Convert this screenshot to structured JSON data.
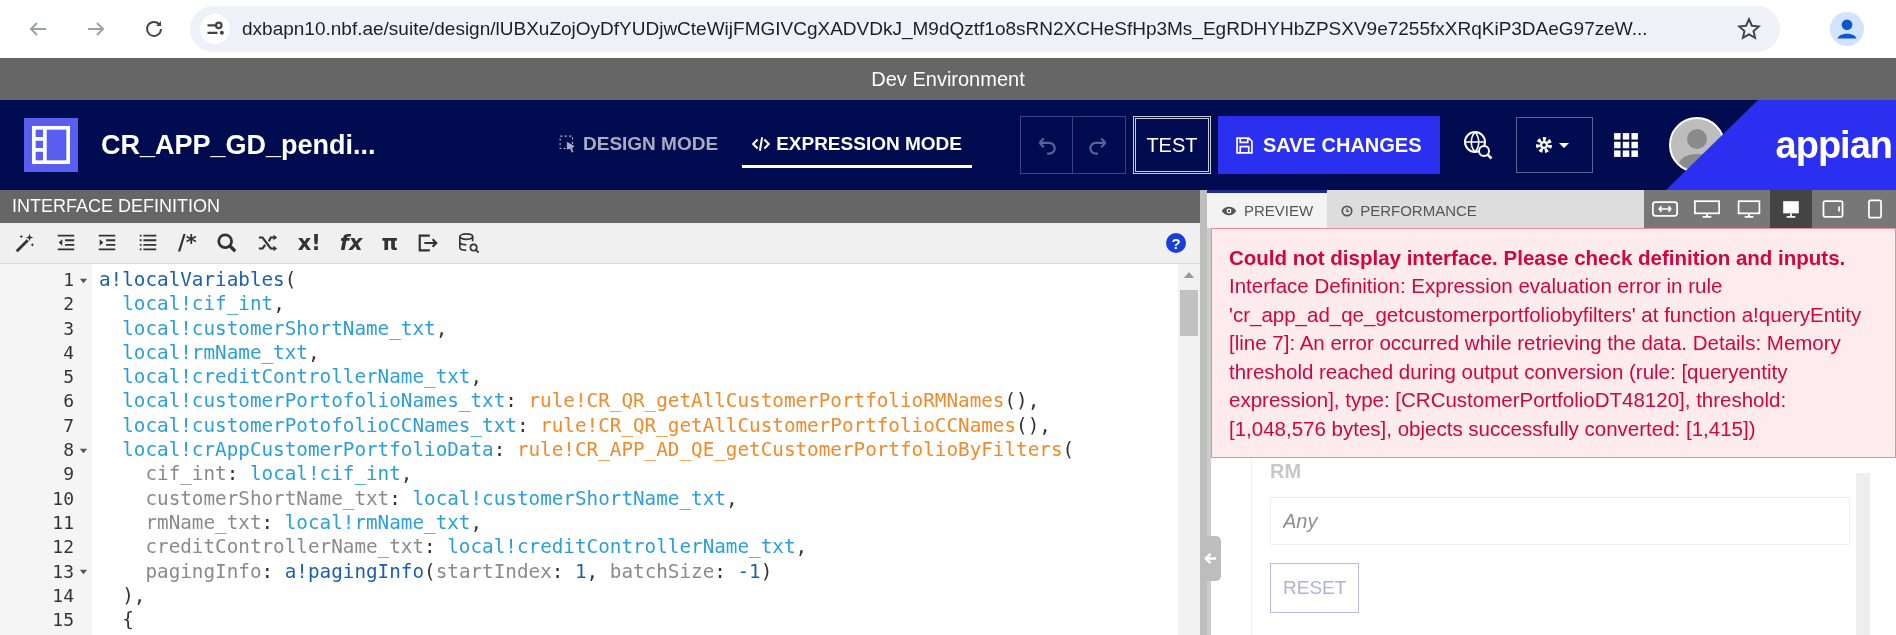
{
  "browser": {
    "url": "dxbapn10.nbf.ae/suite/design/lUBXuZojOyDfYUDjwCteWijFMGIVCgXADVDkJ_M9dQztf1o8sRN2XCHeSfHp3Ms_EgRDHYHbZPSXV9e7255fxXRqKiP3DAeG97zeW..."
  },
  "environment_banner": "Dev Environment",
  "header": {
    "title": "CR_APP_GD_pendi...",
    "modes": [
      {
        "kind": "design",
        "label": "DESIGN MODE",
        "selected": false
      },
      {
        "kind": "expression",
        "label": "EXPRESSION MODE",
        "selected": true
      }
    ],
    "undo": {
      "disabled": true
    },
    "redo": {
      "disabled": true
    },
    "test_button": "TEST",
    "save_button": "SAVE CHANGES",
    "logo": "appian"
  },
  "editor": {
    "title": "INTERFACE DEFINITION",
    "help": "?",
    "toolbar": [
      {
        "kind": "wand"
      },
      {
        "kind": "outdent"
      },
      {
        "kind": "indent"
      },
      {
        "kind": "list"
      },
      {
        "kind": "glyph",
        "text": "/*"
      },
      {
        "kind": "search"
      },
      {
        "kind": "shuffle"
      },
      {
        "kind": "glyph",
        "text": "x!"
      },
      {
        "kind": "glyph",
        "text": "fx"
      },
      {
        "kind": "glyph",
        "text": "π"
      },
      {
        "kind": "export"
      },
      {
        "kind": "db"
      }
    ],
    "lines": [
      {
        "number": "1",
        "foldable": true,
        "tokens": [
          {
            "kind": "function",
            "text": "a!localVariables"
          },
          {
            "kind": "punct",
            "text": "("
          }
        ]
      },
      {
        "number": "2",
        "foldable": false,
        "tokens": [
          {
            "kind": "local",
            "text": "  local!cif_int"
          },
          {
            "kind": "punct",
            "text": ","
          }
        ]
      },
      {
        "number": "3",
        "foldable": false,
        "tokens": [
          {
            "kind": "local",
            "text": "  local!customerShortName_txt"
          },
          {
            "kind": "punct",
            "text": ","
          }
        ]
      },
      {
        "number": "4",
        "foldable": false,
        "tokens": [
          {
            "kind": "local",
            "text": "  local!rmName_txt"
          },
          {
            "kind": "punct",
            "text": ","
          }
        ]
      },
      {
        "number": "5",
        "foldable": false,
        "tokens": [
          {
            "kind": "local",
            "text": "  local!creditControllerName_txt"
          },
          {
            "kind": "punct",
            "text": ","
          }
        ]
      },
      {
        "number": "6",
        "foldable": false,
        "tokens": [
          {
            "kind": "local",
            "text": "  local!customerPortofolioNames_txt"
          },
          {
            "kind": "punct",
            "text": ": "
          },
          {
            "kind": "rule",
            "text": "rule!CR_QR_getAllCustomerPortfolioRMNames"
          },
          {
            "kind": "punct",
            "text": "(),"
          }
        ]
      },
      {
        "number": "7",
        "foldable": false,
        "tokens": [
          {
            "kind": "local",
            "text": "  local!customerPotofolioCCNames_txt"
          },
          {
            "kind": "punct",
            "text": ": "
          },
          {
            "kind": "rule",
            "text": "rule!CR_QR_getAllCustomerPortfolioCCNames"
          },
          {
            "kind": "punct",
            "text": "(),"
          }
        ]
      },
      {
        "number": "8",
        "foldable": true,
        "tokens": [
          {
            "kind": "local",
            "text": "  local!crAppCustomerPortfolioData"
          },
          {
            "kind": "punct",
            "text": ": "
          },
          {
            "kind": "rule",
            "text": "rule!CR_APP_AD_QE_getCustomerPortfolioByFilters"
          },
          {
            "kind": "punct",
            "text": "("
          }
        ]
      },
      {
        "number": "9",
        "foldable": false,
        "tokens": [
          {
            "kind": "param",
            "text": "    cif_int"
          },
          {
            "kind": "punct",
            "text": ": "
          },
          {
            "kind": "local",
            "text": "local!cif_int"
          },
          {
            "kind": "punct",
            "text": ","
          }
        ]
      },
      {
        "number": "10",
        "foldable": false,
        "tokens": [
          {
            "kind": "param",
            "text": "    customerShortName_txt"
          },
          {
            "kind": "punct",
            "text": ": "
          },
          {
            "kind": "local",
            "text": "local!customerShortName_txt"
          },
          {
            "kind": "punct",
            "text": ","
          }
        ]
      },
      {
        "number": "11",
        "foldable": false,
        "tokens": [
          {
            "kind": "param",
            "text": "    rmName_txt"
          },
          {
            "kind": "punct",
            "text": ": "
          },
          {
            "kind": "local",
            "text": "local!rmName_txt"
          },
          {
            "kind": "punct",
            "text": ","
          }
        ]
      },
      {
        "number": "12",
        "foldable": false,
        "tokens": [
          {
            "kind": "param",
            "text": "    creditControllerName_txt"
          },
          {
            "kind": "punct",
            "text": ": "
          },
          {
            "kind": "local",
            "text": "local!creditControllerName_txt"
          },
          {
            "kind": "punct",
            "text": ","
          }
        ]
      },
      {
        "number": "13",
        "foldable": true,
        "tokens": [
          {
            "kind": "param",
            "text": "    pagingInfo"
          },
          {
            "kind": "punct",
            "text": ": "
          },
          {
            "kind": "function",
            "text": "a!pagingInfo"
          },
          {
            "kind": "punct",
            "text": "("
          },
          {
            "kind": "param",
            "text": "startIndex"
          },
          {
            "kind": "punct",
            "text": ": "
          },
          {
            "kind": "number",
            "text": "1"
          },
          {
            "kind": "punct",
            "text": ", "
          },
          {
            "kind": "param",
            "text": "batchSize"
          },
          {
            "kind": "punct",
            "text": ": "
          },
          {
            "kind": "number",
            "text": "-1"
          },
          {
            "kind": "punct",
            "text": ")"
          }
        ]
      },
      {
        "number": "14",
        "foldable": false,
        "tokens": [
          {
            "kind": "punct",
            "text": "  ),"
          }
        ]
      },
      {
        "number": "15",
        "foldable": false,
        "tokens": [
          {
            "kind": "punct",
            "text": "  {"
          }
        ]
      }
    ]
  },
  "preview": {
    "tabs": [
      {
        "kind": "preview",
        "label": "PREVIEW",
        "selected": true
      },
      {
        "kind": "performance",
        "label": "PERFORMANCE",
        "selected": false
      }
    ],
    "device_views": [
      {
        "kind": "fit",
        "selected": false
      },
      {
        "kind": "wide",
        "selected": false
      },
      {
        "kind": "desktop",
        "selected": false
      },
      {
        "kind": "monitor",
        "selected": true
      },
      {
        "kind": "tablet",
        "selected": false
      },
      {
        "kind": "phone",
        "selected": false
      }
    ],
    "error": {
      "title": "Could not display interface. Please check definition and inputs.",
      "message": "Interface Definition: Expression evaluation error in rule 'cr_app_ad_qe_getcustomerportfoliobyfilters' at function a!queryEntity [line 7]: An error occurred while retrieving the data. Details: Memory threshold reached during output conversion (rule: [queryentity expression], type: [CRCustomerPortfolioDT48120], threshold: [1,048,576 bytes], objects successfully converted: [1,415])"
    },
    "form": {
      "rm_label": "RM",
      "rm_placeholder": "Any",
      "reset_button": "RESET"
    }
  }
}
